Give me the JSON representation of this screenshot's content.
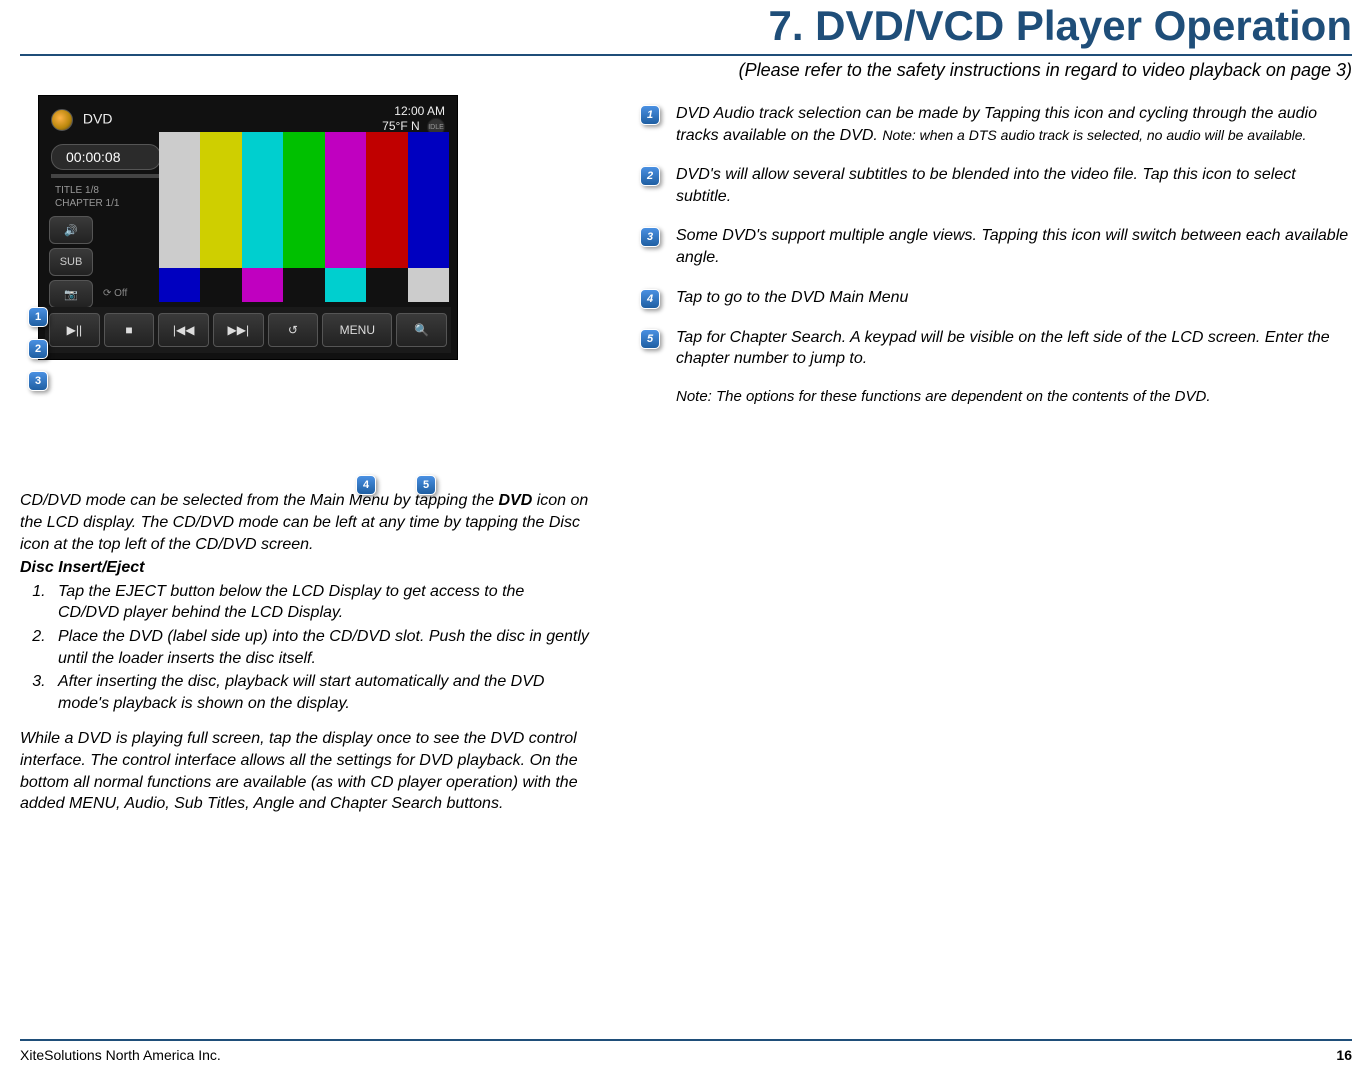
{
  "header": {
    "title": "7. DVD/VCD Player Operation",
    "subtitle_prefix": "(",
    "subtitle": "Please refer to the safety instructions in regard to video playback on page 3)"
  },
  "screenshot": {
    "label_dvd": "DVD",
    "time": "12:00 AM",
    "temp": "75°F   N",
    "idle": "IDLE",
    "timer": "00:00:08",
    "title_line": "TITLE   1/8",
    "chapter_line": "CHAPTER  1/1",
    "side": {
      "audio": "🔊",
      "sub": "SUB",
      "angle": "📷"
    },
    "off": "⟳ Off",
    "controls": {
      "play": "▶||",
      "stop": "■",
      "prev": "|◀◀",
      "next": "▶▶|",
      "repeat": "↺",
      "menu": "MENU",
      "search": "🔍"
    }
  },
  "callouts": {
    "c1": "1",
    "c2": "2",
    "c3": "3",
    "c4": "4",
    "c5": "5"
  },
  "desc": {
    "i1_main": "DVD Audio track selection can be made by Tapping this icon and cycling through the audio tracks available on the DVD. ",
    "i1_note": "Note: when a DTS audio track is selected, no audio will be available.",
    "i2": "DVD's will allow several subtitles to be blended into the video file. Tap this icon to select subtitle.",
    "i3": "Some DVD's support multiple angle views. Tapping this icon will switch between each available angle.",
    "i4": "Tap to go to the DVD Main Menu",
    "i5": "Tap for Chapter Search. A keypad will be visible on the left side of the LCD screen. Enter the chapter number to jump to.",
    "note": "Note: The options for these functions are dependent on the contents of the DVD."
  },
  "left": {
    "intro_a": "CD/DVD mode can be selected from the Main Menu by tapping the ",
    "intro_bold": "DVD",
    "intro_b": " icon on the LCD display. The CD/DVD mode can be left at any time by tapping the Disc icon at the top left of the CD/DVD screen.",
    "heading": "Disc Insert/Eject",
    "step1": "Tap the EJECT button below the LCD Display to get access to the CD/DVD player behind the LCD Display.",
    "step2": "Place the DVD (label side up) into the CD/DVD slot. Push the disc in gently until the loader inserts the disc itself.",
    "step3": "After inserting the disc, playback will start automatically and the DVD mode's playback is shown on the display.",
    "para2": "While a DVD is playing full screen, tap the display once to see the DVD control interface. The control interface allows all the settings for DVD playback. On the bottom all normal functions are available (as with CD player operation) with the added MENU, Audio, Sub Titles, Angle and Chapter Search buttons."
  },
  "footer": {
    "company": "XiteSolutions North America Inc.",
    "page": "16"
  }
}
